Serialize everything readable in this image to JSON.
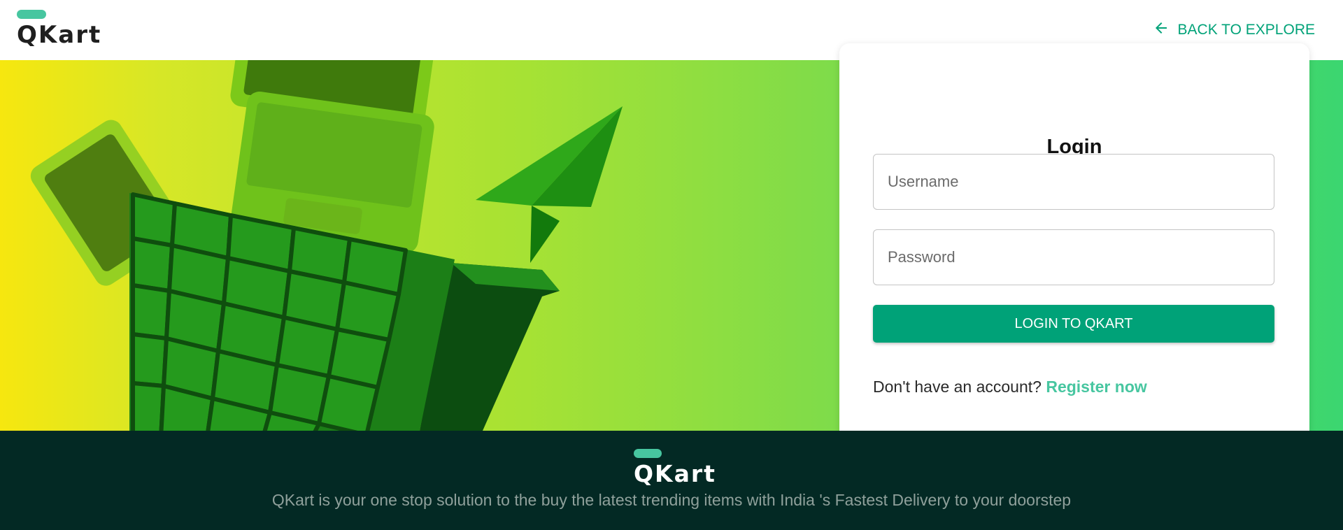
{
  "header": {
    "logo_text": "QKart",
    "back_label": "BACK TO EXPLORE"
  },
  "login": {
    "title": "Login",
    "username_placeholder": "Username",
    "password_placeholder": "Password",
    "submit_label": "LOGIN TO QKART",
    "register_prompt": "Don't have an account?",
    "register_link": "Register now"
  },
  "footer": {
    "logo_text": "QKart",
    "tagline": "QKart is your one stop solution to the buy the latest trending items with India 's Fastest Delivery to your doorstep"
  },
  "icons": {
    "back": "arrow-left-icon",
    "brand_pill": "logo-pill-icon"
  },
  "colors": {
    "accent": "#00a278",
    "brand_pill": "#47c6a0",
    "footer_bg": "#032924",
    "footer_text": "#8fa09b"
  }
}
